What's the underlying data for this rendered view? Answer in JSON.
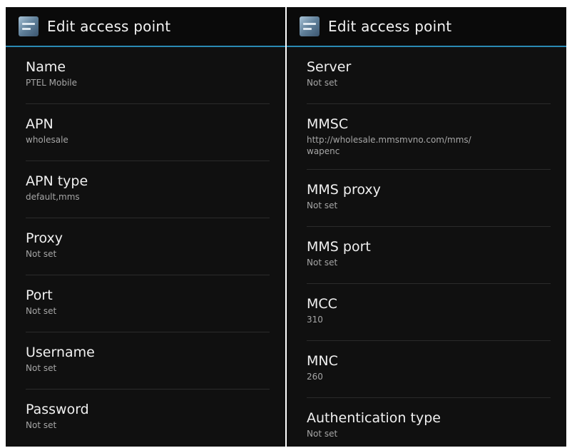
{
  "left_screen": {
    "title": "Edit access point",
    "items": [
      {
        "label": "Name",
        "value": "PTEL Mobile"
      },
      {
        "label": "APN",
        "value": "wholesale"
      },
      {
        "label": "APN type",
        "value": "default,mms"
      },
      {
        "label": "Proxy",
        "value": "Not set"
      },
      {
        "label": "Port",
        "value": "Not set"
      },
      {
        "label": "Username",
        "value": "Not set"
      },
      {
        "label": "Password",
        "value": "Not set"
      }
    ]
  },
  "right_screen": {
    "title": "Edit access point",
    "items": [
      {
        "label": "Server",
        "value": "Not set"
      },
      {
        "label": "MMSC",
        "value": "http://wholesale.mmsmvno.com/mms/\nwapenc"
      },
      {
        "label": "MMS proxy",
        "value": "Not set"
      },
      {
        "label": "MMS port",
        "value": "Not set"
      },
      {
        "label": "MCC",
        "value": "310"
      },
      {
        "label": "MNC",
        "value": "260"
      },
      {
        "label": "Authentication type",
        "value": "Not set"
      }
    ]
  },
  "colors": {
    "background": "#101010",
    "accent_line": "#2a8ab4",
    "title_text": "#f0f0f0",
    "summary_text": "#a6a6a6"
  },
  "icons": {
    "app": "settings-apn-icon"
  }
}
